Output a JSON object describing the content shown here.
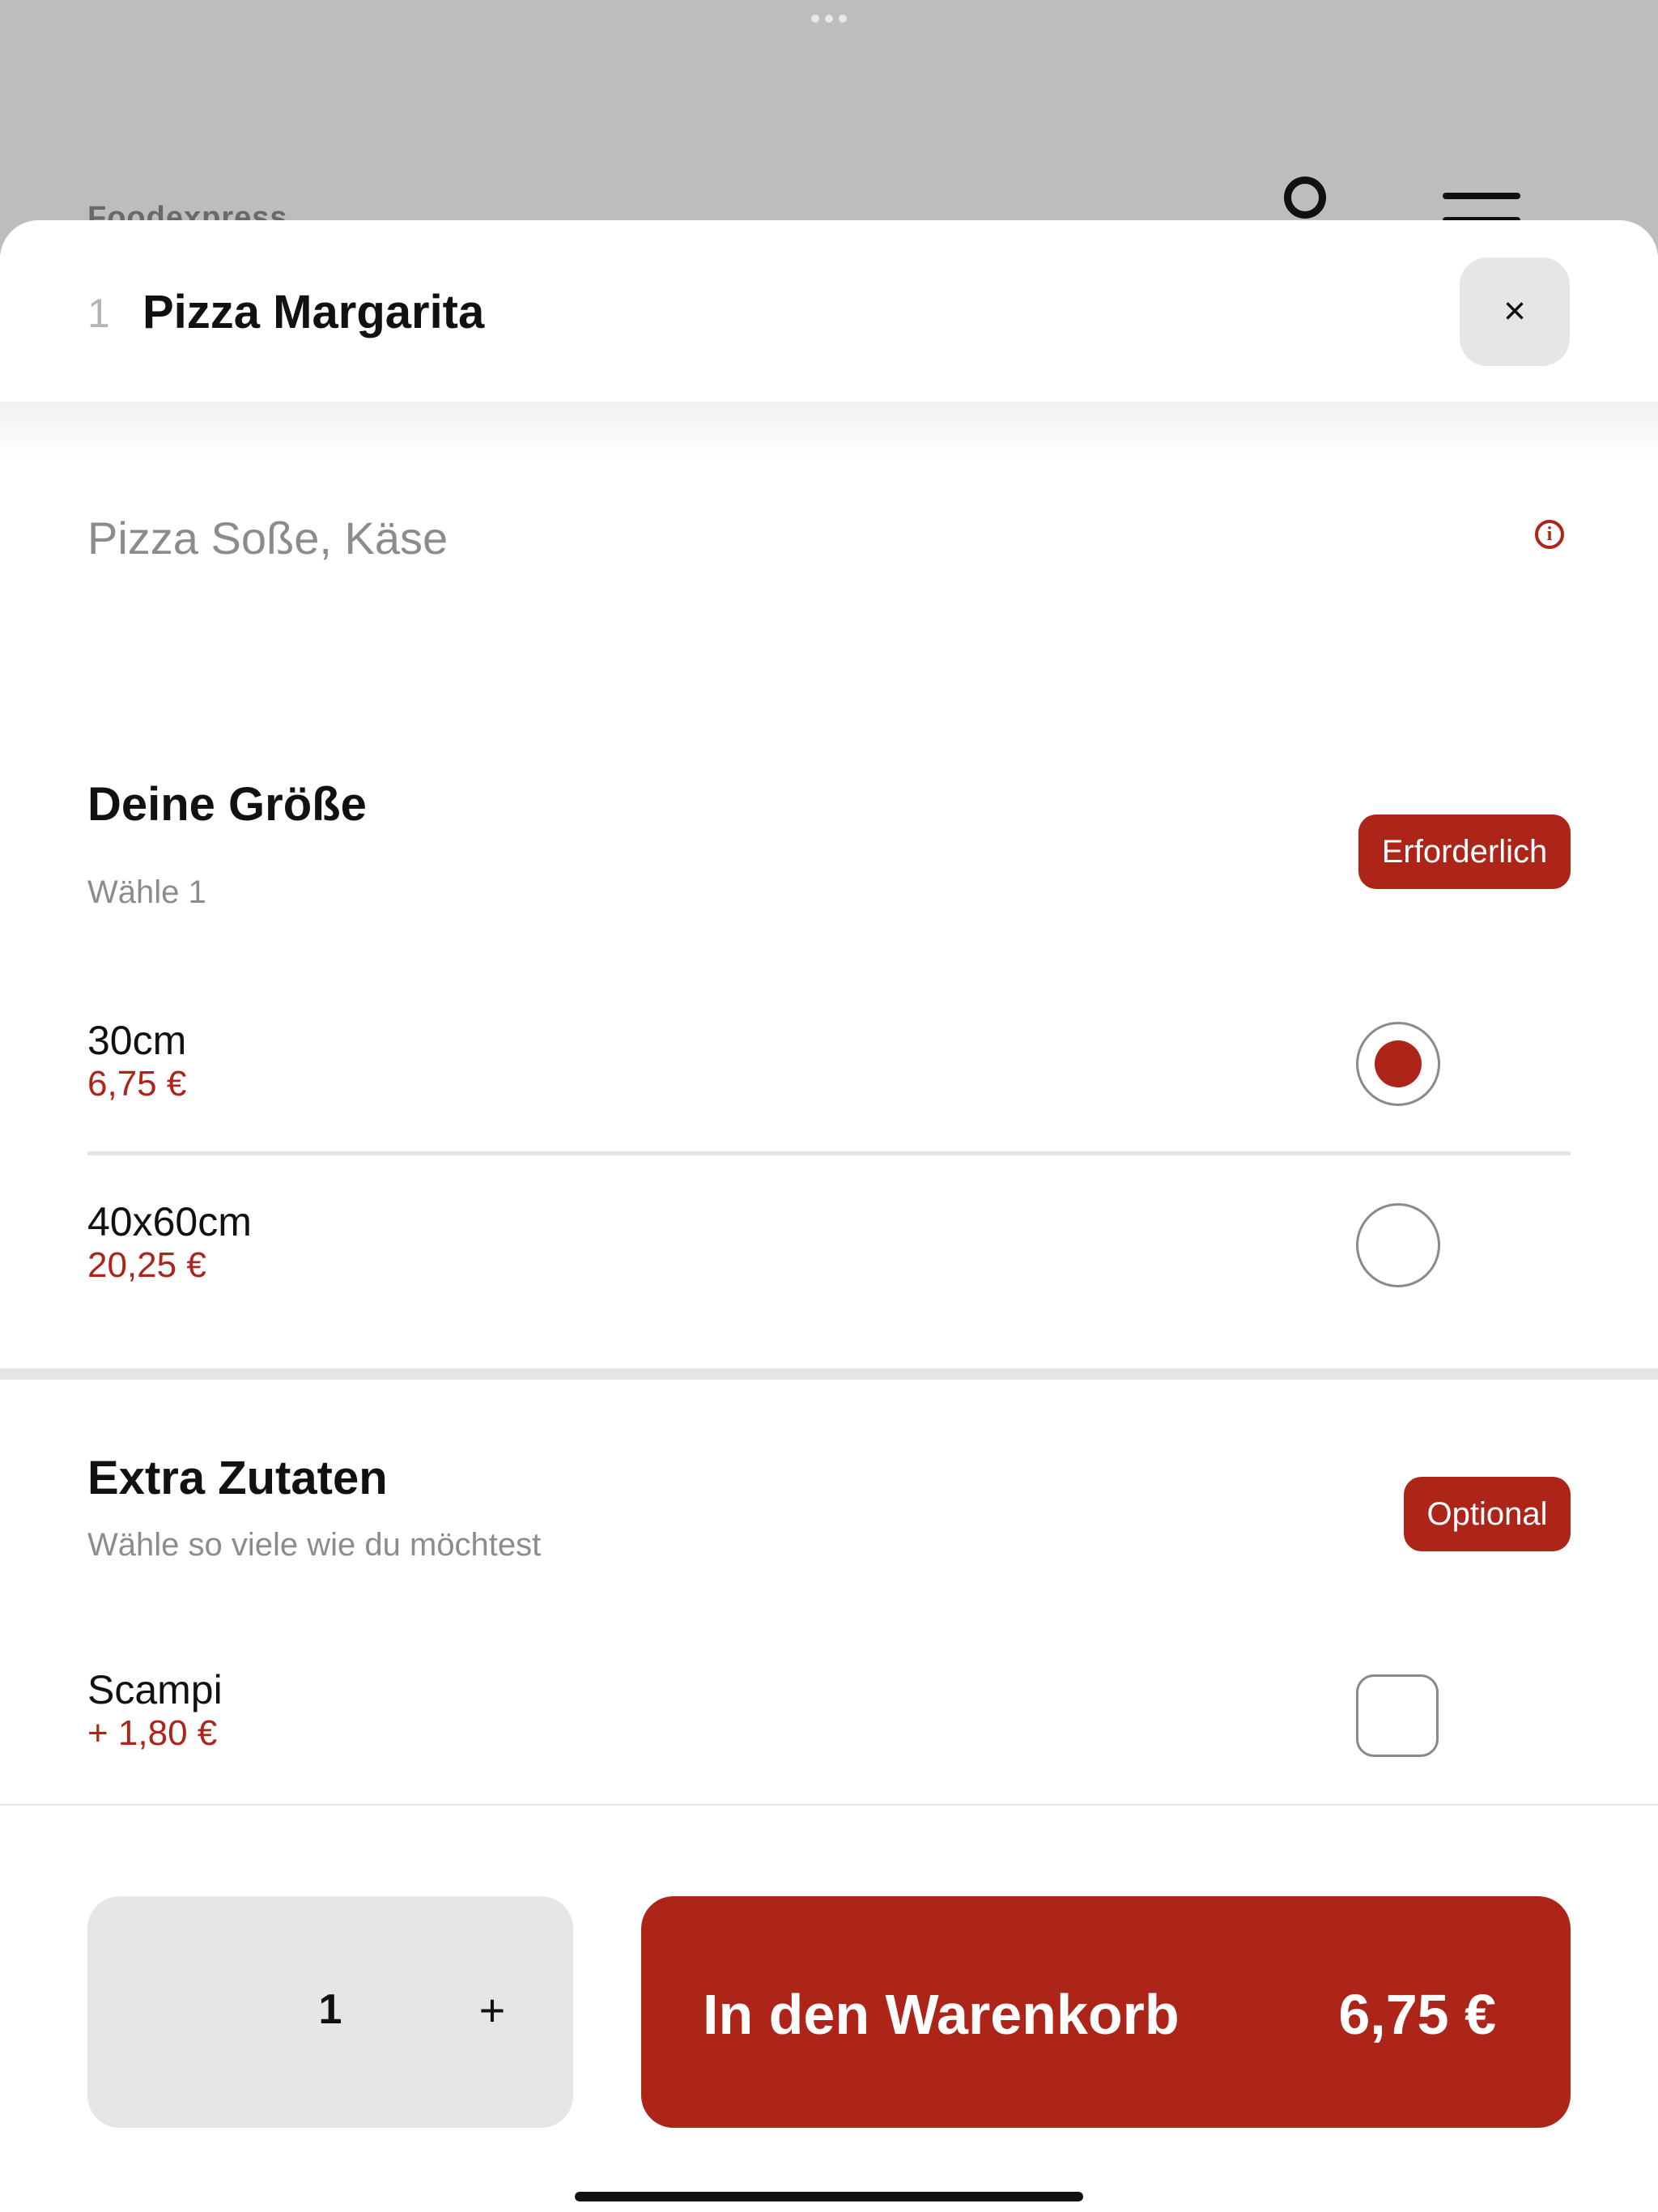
{
  "background": {
    "brand": "Foodexpress"
  },
  "header": {
    "item_number": "1",
    "title": "Pizza Margarita",
    "close_label": "×"
  },
  "description": "Pizza Soße, Käse",
  "info_icon_glyph": "i",
  "size_section": {
    "title": "Deine Größe",
    "subtitle": "Wähle 1",
    "badge": "Erforderlich",
    "options": [
      {
        "label": "30cm",
        "price": "6,75 €",
        "selected": true
      },
      {
        "label": "40x60cm",
        "price": "20,25 €",
        "selected": false
      }
    ]
  },
  "extras_section": {
    "title": "Extra Zutaten",
    "subtitle": "Wähle so viele wie du möchtest",
    "badge": "Optional",
    "options": [
      {
        "label": "Scampi",
        "price": "+ 1,80 €",
        "checked": false
      }
    ]
  },
  "footer": {
    "quantity": "1",
    "plus_label": "+",
    "cart_label": "In den Warenkorb",
    "cart_price": "6,75 €"
  },
  "colors": {
    "accent": "#ad2418",
    "muted_text": "#8c8c8c",
    "control_bg": "#e6e6e6"
  },
  "icons": [
    "user-icon",
    "menu-icon",
    "close-icon",
    "info-icon",
    "plus-icon"
  ]
}
